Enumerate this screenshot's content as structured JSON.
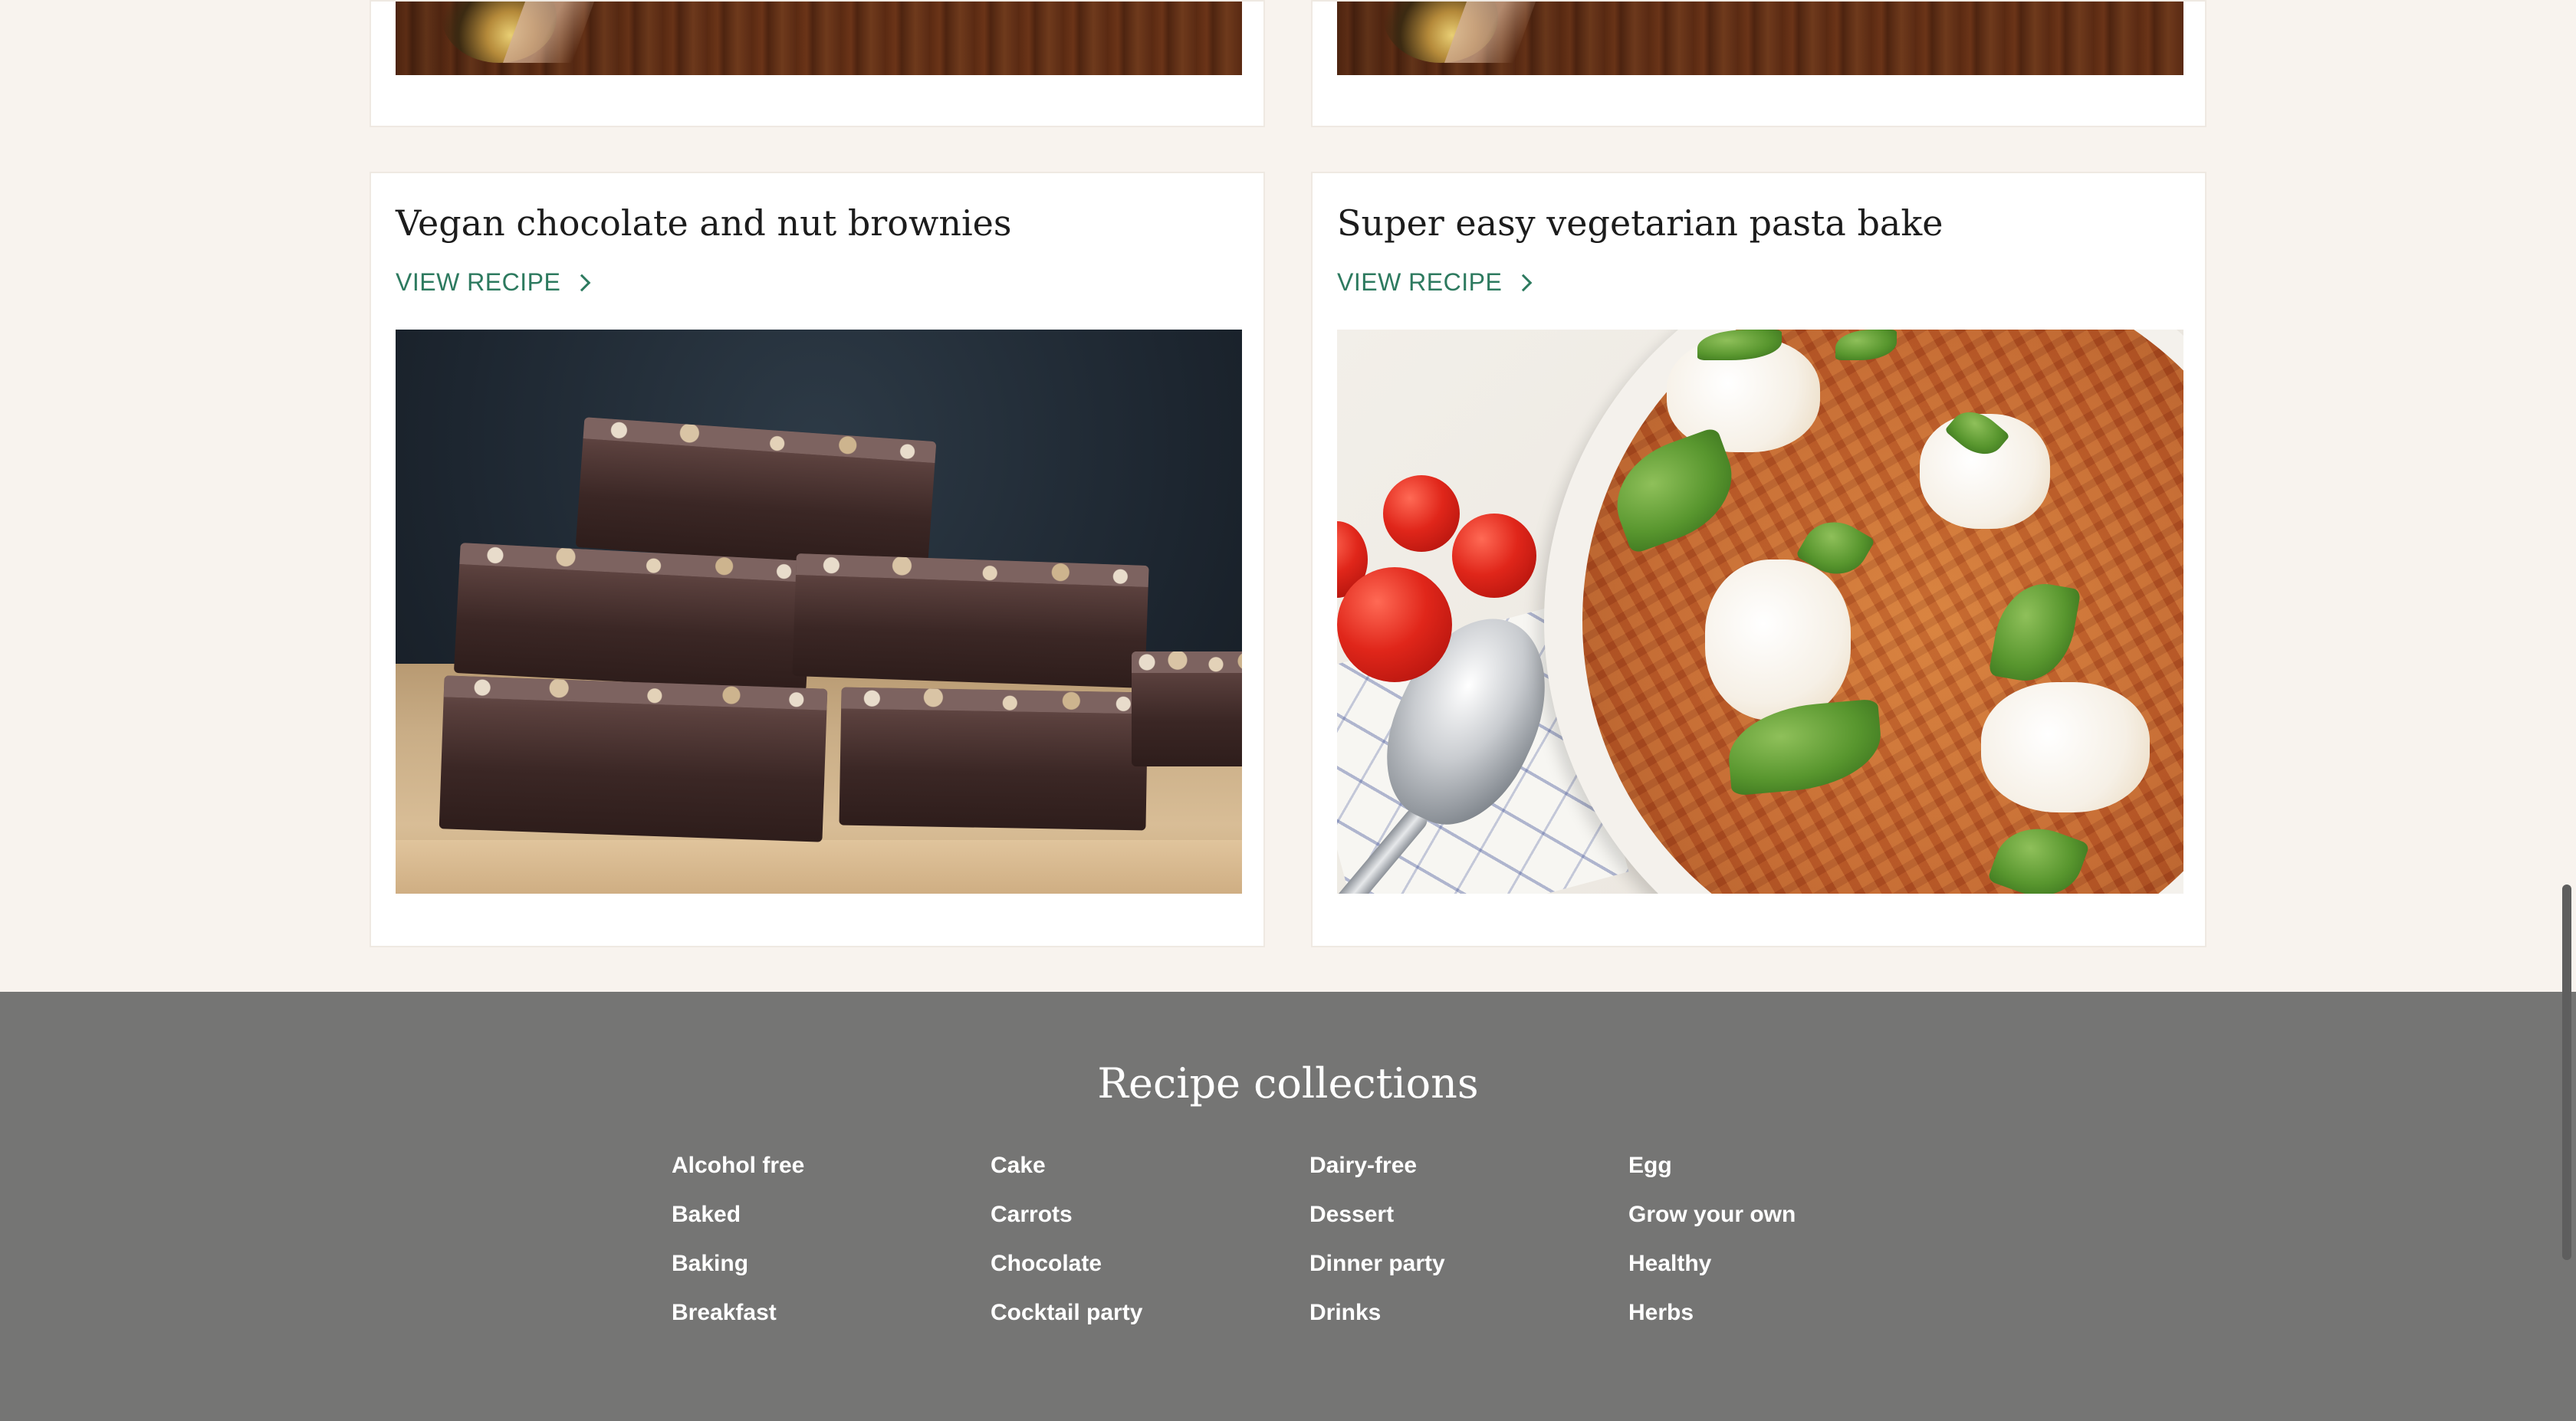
{
  "recipes": {
    "cards": [
      {
        "title": "Vegan chocolate and nut brownies",
        "view_label": "VIEW RECIPE"
      },
      {
        "title": "Super easy vegetarian pasta bake",
        "view_label": "VIEW RECIPE"
      }
    ]
  },
  "footer": {
    "title": "Recipe collections",
    "collections": [
      "Alcohol free",
      "Baked",
      "Baking",
      "Breakfast",
      "Cake",
      "Carrots",
      "Chocolate",
      "Cocktail party",
      "Dairy-free",
      "Dessert",
      "Dinner party",
      "Drinks",
      "Egg",
      "Grow your own",
      "Healthy",
      "Herbs"
    ]
  },
  "colors": {
    "background": "#f8f3ee",
    "card": "#ffffff",
    "link_green": "#2d7a5f",
    "footer_bg": "#757574",
    "footer_text": "#ffffff"
  },
  "icons": {
    "view_recipe": "chevron-right-icon"
  }
}
